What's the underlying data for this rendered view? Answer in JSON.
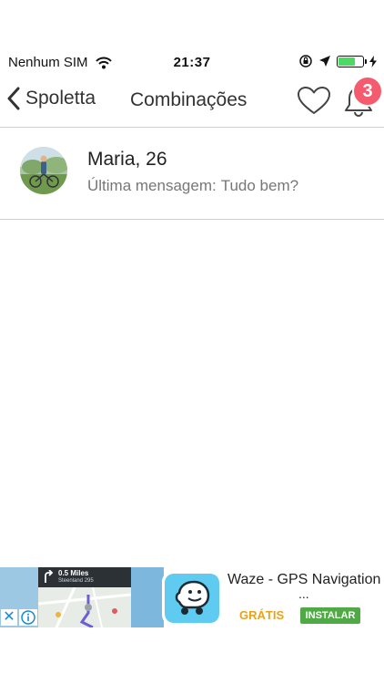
{
  "status_bar": {
    "carrier": "Nenhum SIM",
    "time": "21:37",
    "battery_level": 0.7,
    "battery_color": "#4cd964"
  },
  "nav": {
    "back_label": "Spoletta",
    "title": "Combinações",
    "favorites_icon": "heart-icon",
    "notifications_icon": "bell-icon",
    "notification_count": "3",
    "badge_color": "#f45b6e"
  },
  "matches": [
    {
      "name": "Maria, 26",
      "last_message_prefix": "Última mensagem:",
      "last_message": "Tudo bem?"
    }
  ],
  "ad": {
    "map_distance": "0.5 Miles",
    "map_street": "Steenland 295",
    "app_title": "Waze - GPS Navigation",
    "ellipsis": "...",
    "price": "GRÁTIS",
    "install_label": "INSTALAR",
    "price_color": "#e8a21d",
    "install_color": "#4fa945",
    "close_icon": "close-icon",
    "info_icon": "info-icon"
  }
}
